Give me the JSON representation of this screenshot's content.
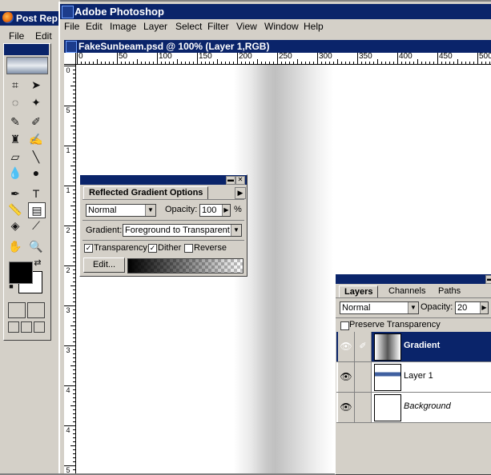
{
  "background_window": {
    "title": "Post Rep",
    "menu": [
      "File",
      "Edit"
    ]
  },
  "app": {
    "title": "Adobe Photoshop",
    "menu": [
      "File",
      "Edit",
      "Image",
      "Layer",
      "Select",
      "Filter",
      "View",
      "Window",
      "Help"
    ]
  },
  "document": {
    "title": "FakeSunbeam.psd @ 100% (Layer 1,RGB)",
    "h_ruler_labels": [
      "0",
      "50",
      "100",
      "150",
      "200",
      "250",
      "300",
      "350",
      "400",
      "450",
      "500"
    ],
    "v_ruler_labels": [
      "0",
      "5",
      "1",
      "1",
      "2",
      "2",
      "3",
      "3",
      "4",
      "4",
      "5"
    ]
  },
  "gradient_options": {
    "tab_label": "Reflected Gradient Options",
    "mode": "Normal",
    "opacity_label": "Opacity:",
    "opacity_value": "100",
    "percent": "%",
    "gradient_label": "Gradient:",
    "gradient_value": "Foreground to Transparent",
    "transparency_label": "Transparency",
    "transparency_checked": true,
    "dither_label": "Dither",
    "dither_checked": true,
    "reverse_label": "Reverse",
    "reverse_checked": false,
    "edit_label": "Edit..."
  },
  "layers_palette": {
    "tabs": [
      "Layers",
      "Channels",
      "Paths"
    ],
    "mode": "Normal",
    "opacity_label": "Opacity:",
    "opacity_value": "20",
    "preserve_label": "Preserve Transparency",
    "layers": [
      {
        "name": "Gradient",
        "selected": true
      },
      {
        "name": "Layer 1",
        "selected": false
      },
      {
        "name": "Background",
        "selected": false
      }
    ]
  },
  "colors": {
    "title_bar": "#0a246a",
    "chrome": "#d4d0c8",
    "foreground_color": "#000000",
    "background_color": "#ffffff"
  }
}
